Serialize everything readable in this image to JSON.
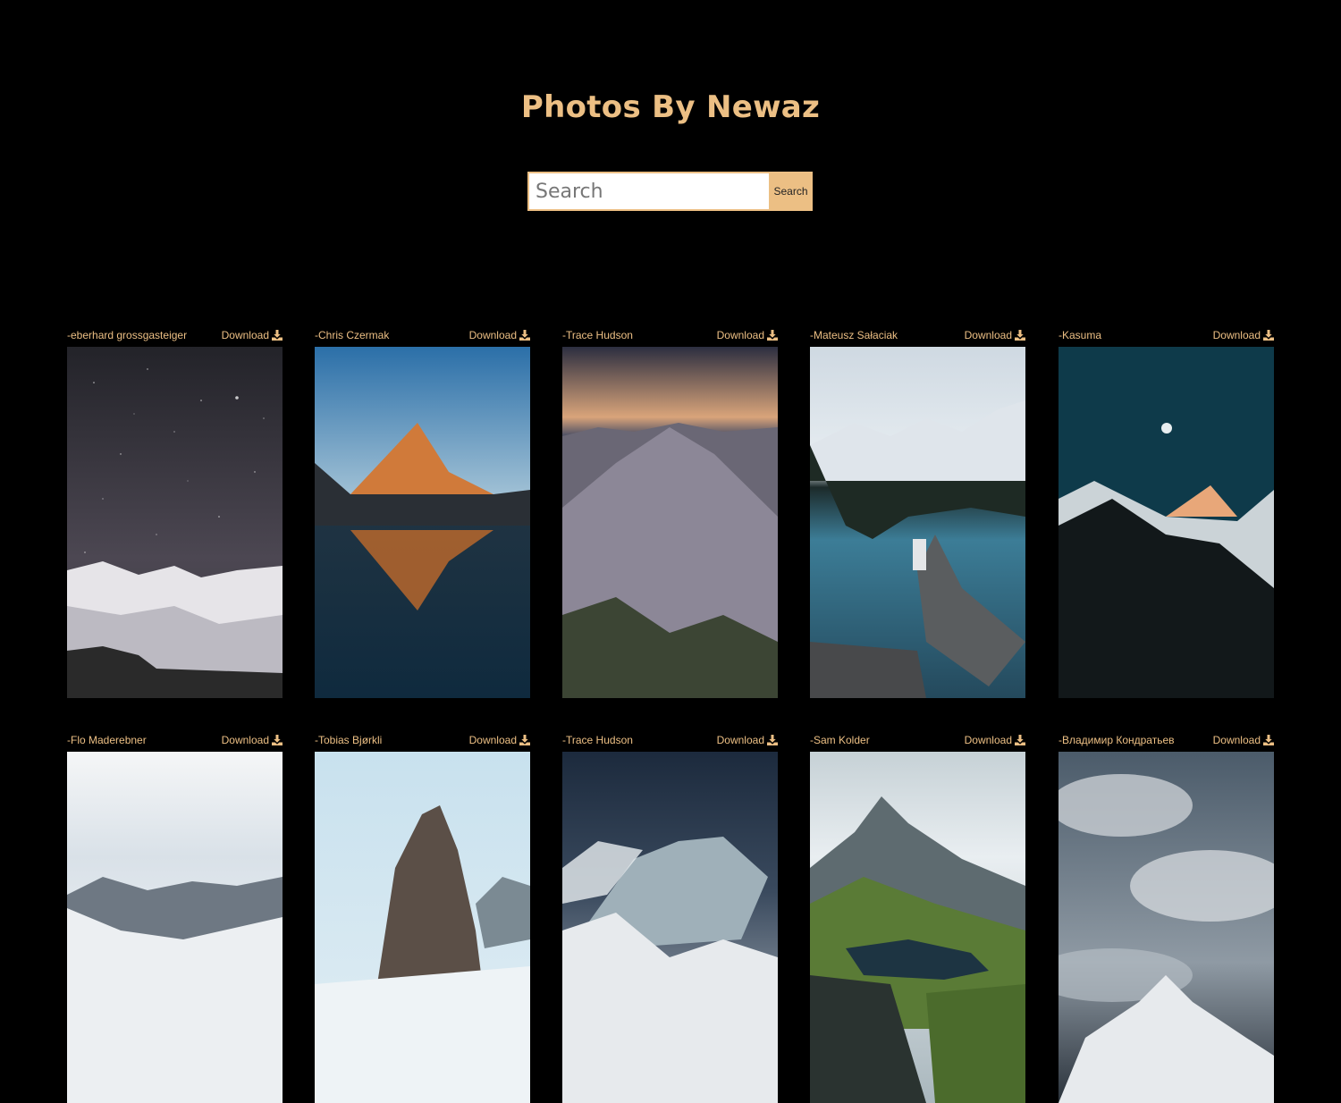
{
  "title": "Photos By Newaz",
  "search": {
    "placeholder": "Search",
    "button": "Search"
  },
  "download_label": "Download",
  "photos": [
    {
      "author": "-eberhard grossgasteiger"
    },
    {
      "author": "-Chris Czermak"
    },
    {
      "author": "-Trace Hudson"
    },
    {
      "author": "-Mateusz Sałaciak"
    },
    {
      "author": "-Kasuma"
    },
    {
      "author": "-Flo Maderebner"
    },
    {
      "author": "-Tobias Bjørkli"
    },
    {
      "author": "-Trace Hudson"
    },
    {
      "author": "-Sam Kolder"
    },
    {
      "author": "-Владимир Кондратьев"
    }
  ],
  "colors": {
    "accent": "#ecbf84",
    "background": "#000000"
  }
}
